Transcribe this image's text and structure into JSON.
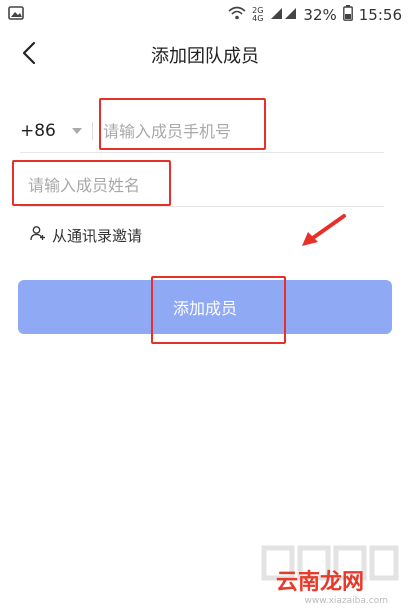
{
  "status_bar": {
    "battery_percent": "32%",
    "time": "15:56",
    "net_top": "2G",
    "net_bottom": "4G"
  },
  "header": {
    "title": "添加团队成员"
  },
  "form": {
    "country_code": "+86",
    "phone_placeholder": "请输入成员手机号",
    "name_placeholder": "请输入成员姓名",
    "invite_link_label": "从通讯录邀请",
    "submit_label": "添加成员"
  },
  "watermark": {
    "brand": "云南龙网",
    "url": "www.xiazaiba.com"
  },
  "colors": {
    "accent_button": "#8fa9f5",
    "annotation_red": "#e8302a"
  }
}
